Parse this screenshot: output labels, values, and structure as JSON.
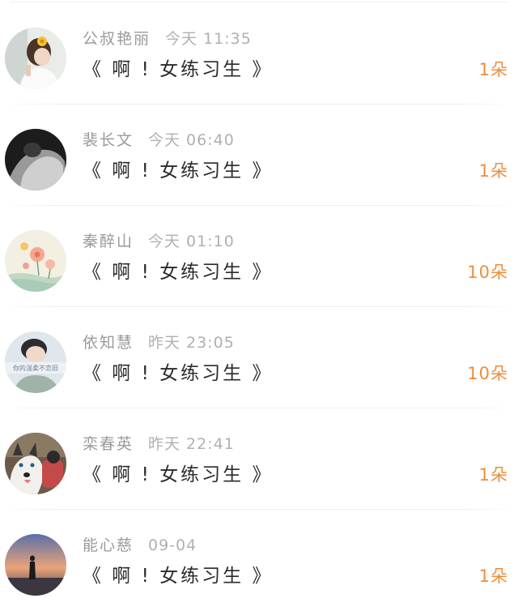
{
  "records": [
    {
      "name": "公叔艳丽",
      "time": "今天 11:35",
      "title": "《 啊 ! 女练习生 》",
      "amount": "1朵",
      "avatar": "girl-flower-hair"
    },
    {
      "name": "裴长文",
      "time": "今天 06:40",
      "title": "《 啊 ! 女练习生 》",
      "amount": "1朵",
      "avatar": "monochrome-back"
    },
    {
      "name": "秦醉山",
      "time": "今天 01:10",
      "title": "《 啊 ! 女练习生 》",
      "amount": "10朵",
      "avatar": "flower-illustration"
    },
    {
      "name": "依知慧",
      "time": "昨天 23:05",
      "title": "《 啊 ! 女练习生 》",
      "amount": "10朵",
      "avatar": "boy-text",
      "avatar_caption": "你的温柔不恋旧"
    },
    {
      "name": "栾春英",
      "time": "昨天 22:41",
      "title": "《 啊 ! 女练习生 》",
      "amount": "1朵",
      "avatar": "husky-dog"
    },
    {
      "name": "能心慈",
      "time": "09-04",
      "title": "《 啊 ! 女练习生 》",
      "amount": "1朵",
      "avatar": "sunset-silhouette"
    }
  ]
}
